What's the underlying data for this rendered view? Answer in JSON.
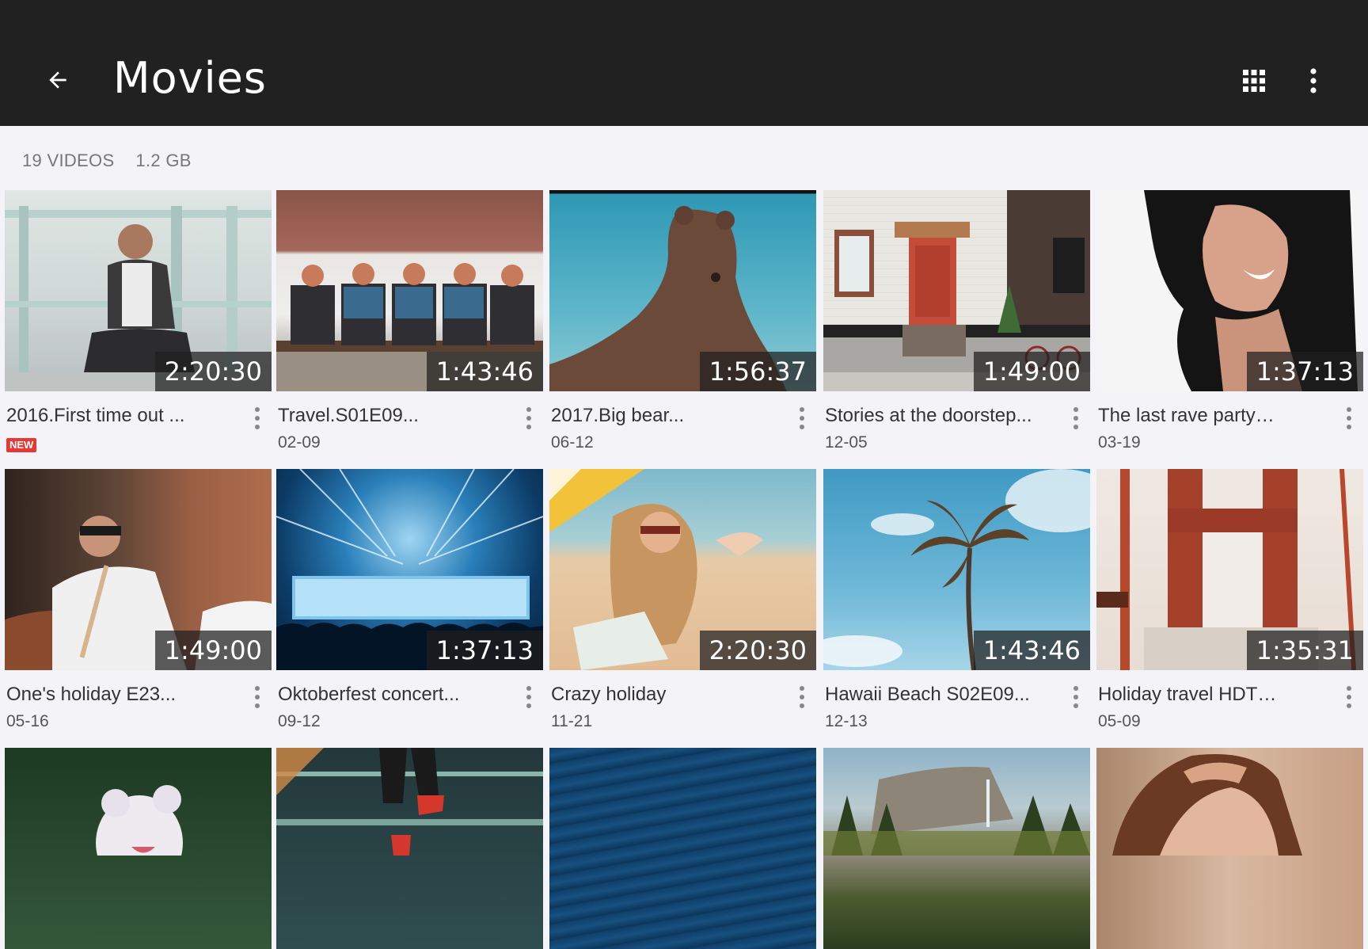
{
  "header": {
    "title": "Movies",
    "back_icon": "arrow-back-icon",
    "view_icon": "grid-view-icon",
    "menu_icon": "more-vert-icon"
  },
  "summary": {
    "count": "19 VIDEOS",
    "size": "1.2 GB"
  },
  "colors": {
    "appbar": "#212121",
    "background": "#f4f4f8",
    "new_badge": "#e53935"
  },
  "videos": [
    {
      "title": "2016.First time out ...",
      "duration": "2:20:30",
      "date": "",
      "badge": "NEW"
    },
    {
      "title": "Travel.S01E09...",
      "duration": "1:43:46",
      "date": "02-09"
    },
    {
      "title": "2017.Big bear...",
      "duration": "1:56:37",
      "date": "06-12"
    },
    {
      "title": "Stories at the doorstep...",
      "duration": "1:49:00",
      "date": "12-05"
    },
    {
      "title": "The last rave party…",
      "duration": "1:37:13",
      "date": "03-19"
    },
    {
      "title": "One's holiday E23...",
      "duration": "1:49:00",
      "date": "05-16"
    },
    {
      "title": "Oktoberfest concert...",
      "duration": "1:37:13",
      "date": "09-12"
    },
    {
      "title": "Crazy holiday",
      "duration": "2:20:30",
      "date": "11-21"
    },
    {
      "title": "Hawaii Beach S02E09...",
      "duration": "1:43:46",
      "date": "12-13"
    },
    {
      "title": "Holiday travel HDT…",
      "duration": "1:35:31",
      "date": "05-09"
    },
    {
      "title": "",
      "duration": "",
      "date": ""
    },
    {
      "title": "",
      "duration": "",
      "date": ""
    },
    {
      "title": "",
      "duration": "",
      "date": ""
    },
    {
      "title": "",
      "duration": "",
      "date": ""
    },
    {
      "title": "",
      "duration": "",
      "date": ""
    }
  ]
}
